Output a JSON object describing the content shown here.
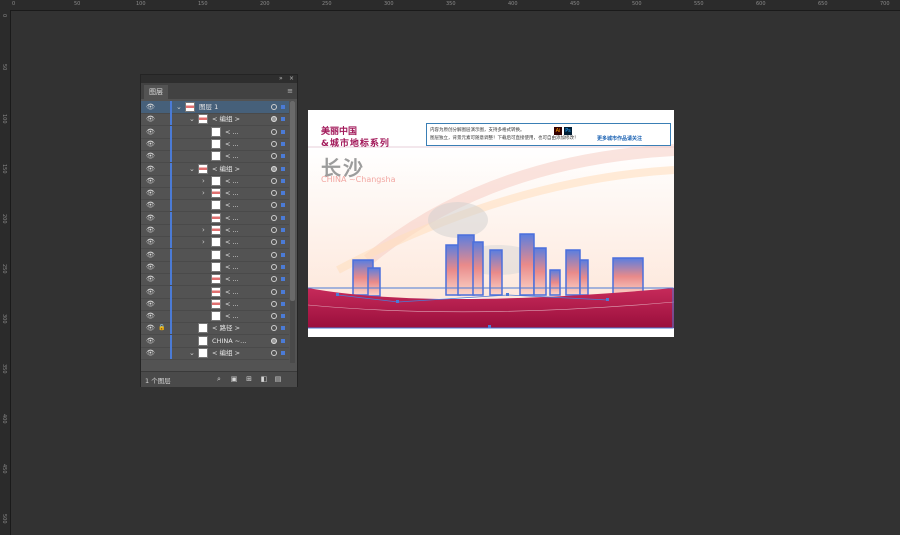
{
  "ruler": {
    "top": [
      "0",
      "50",
      "100",
      "150",
      "200",
      "250",
      "300",
      "350",
      "400",
      "450",
      "500",
      "550",
      "600",
      "650",
      "700"
    ],
    "left": [
      "0",
      "50",
      "100",
      "150",
      "200",
      "250",
      "300",
      "350",
      "400",
      "450",
      "500"
    ]
  },
  "panel": {
    "tab_label": "图层",
    "collapse_glyph": "»",
    "close_glyph": "×",
    "menu_glyph": "≡",
    "footer_text": "1 个图层",
    "rows": [
      {
        "label": "图层 1",
        "indent": 0,
        "arrow": "v",
        "selected": true,
        "lock": false,
        "thumb": "red"
      },
      {
        "label": "< 编组 >",
        "indent": 1,
        "arrow": "v",
        "selected": false,
        "lock": false,
        "thumb": "red",
        "target_filled": true
      },
      {
        "label": "< ...",
        "indent": 2,
        "arrow": "",
        "selected": false,
        "lock": false,
        "thumb": "white"
      },
      {
        "label": "< ...",
        "indent": 2,
        "arrow": "",
        "selected": false,
        "lock": false,
        "thumb": "white"
      },
      {
        "label": "< ...",
        "indent": 2,
        "arrow": "",
        "selected": false,
        "lock": false,
        "thumb": "white"
      },
      {
        "label": "< 编组 >",
        "indent": 1,
        "arrow": "v",
        "selected": false,
        "lock": false,
        "thumb": "red",
        "target_filled": true
      },
      {
        "label": "< ...",
        "indent": 2,
        "arrow": ">",
        "selected": false,
        "lock": false,
        "thumb": "white"
      },
      {
        "label": "< ...",
        "indent": 2,
        "arrow": ">",
        "selected": false,
        "lock": false,
        "thumb": "red"
      },
      {
        "label": "< ...",
        "indent": 2,
        "arrow": "",
        "selected": false,
        "lock": false,
        "thumb": "white"
      },
      {
        "label": "< ...",
        "indent": 2,
        "arrow": "",
        "selected": false,
        "lock": false,
        "thumb": "red"
      },
      {
        "label": "< ...",
        "indent": 2,
        "arrow": ">",
        "selected": false,
        "lock": false,
        "thumb": "red"
      },
      {
        "label": "< ...",
        "indent": 2,
        "arrow": ">",
        "selected": false,
        "lock": false,
        "thumb": "white"
      },
      {
        "label": "< ...",
        "indent": 2,
        "arrow": "",
        "selected": false,
        "lock": false,
        "thumb": "white"
      },
      {
        "label": "< ...",
        "indent": 2,
        "arrow": "",
        "selected": false,
        "lock": false,
        "thumb": "white"
      },
      {
        "label": "< ...",
        "indent": 2,
        "arrow": "",
        "selected": false,
        "lock": false,
        "thumb": "red"
      },
      {
        "label": "< ...",
        "indent": 2,
        "arrow": "",
        "selected": false,
        "lock": false,
        "thumb": "red"
      },
      {
        "label": "< ...",
        "indent": 2,
        "arrow": "",
        "selected": false,
        "lock": false,
        "thumb": "red"
      },
      {
        "label": "< ...",
        "indent": 2,
        "arrow": "",
        "selected": false,
        "lock": false,
        "thumb": "white"
      },
      {
        "label": "< 路径 >",
        "indent": 1,
        "arrow": "",
        "selected": false,
        "lock": true,
        "thumb": "white"
      },
      {
        "label": "CHINA ~...",
        "indent": 1,
        "arrow": "",
        "selected": false,
        "lock": false,
        "thumb": "white",
        "target_filled": true
      },
      {
        "label": "< 编组 >",
        "indent": 1,
        "arrow": "v",
        "selected": false,
        "lock": false,
        "thumb": "white"
      }
    ]
  },
  "artboard": {
    "title_line1": "美丽中国",
    "title_line2": "&城市地标系列",
    "city_name": "长沙",
    "city_en": "CHINA ~Changsha",
    "note_line1": "内容为原创分解图层演示图，支持多格式转换。",
    "note_line2": "图层独立，背景元素可随意调整！下载后可直接使用，也可自由添加修改！",
    "note_link": "更多城市作品请关注",
    "badge_ai": "Ai",
    "badge_ps": "Ps"
  },
  "colors": {
    "accent": "#a2195a",
    "selection": "#4b7bd6",
    "canvas": "#323232"
  }
}
